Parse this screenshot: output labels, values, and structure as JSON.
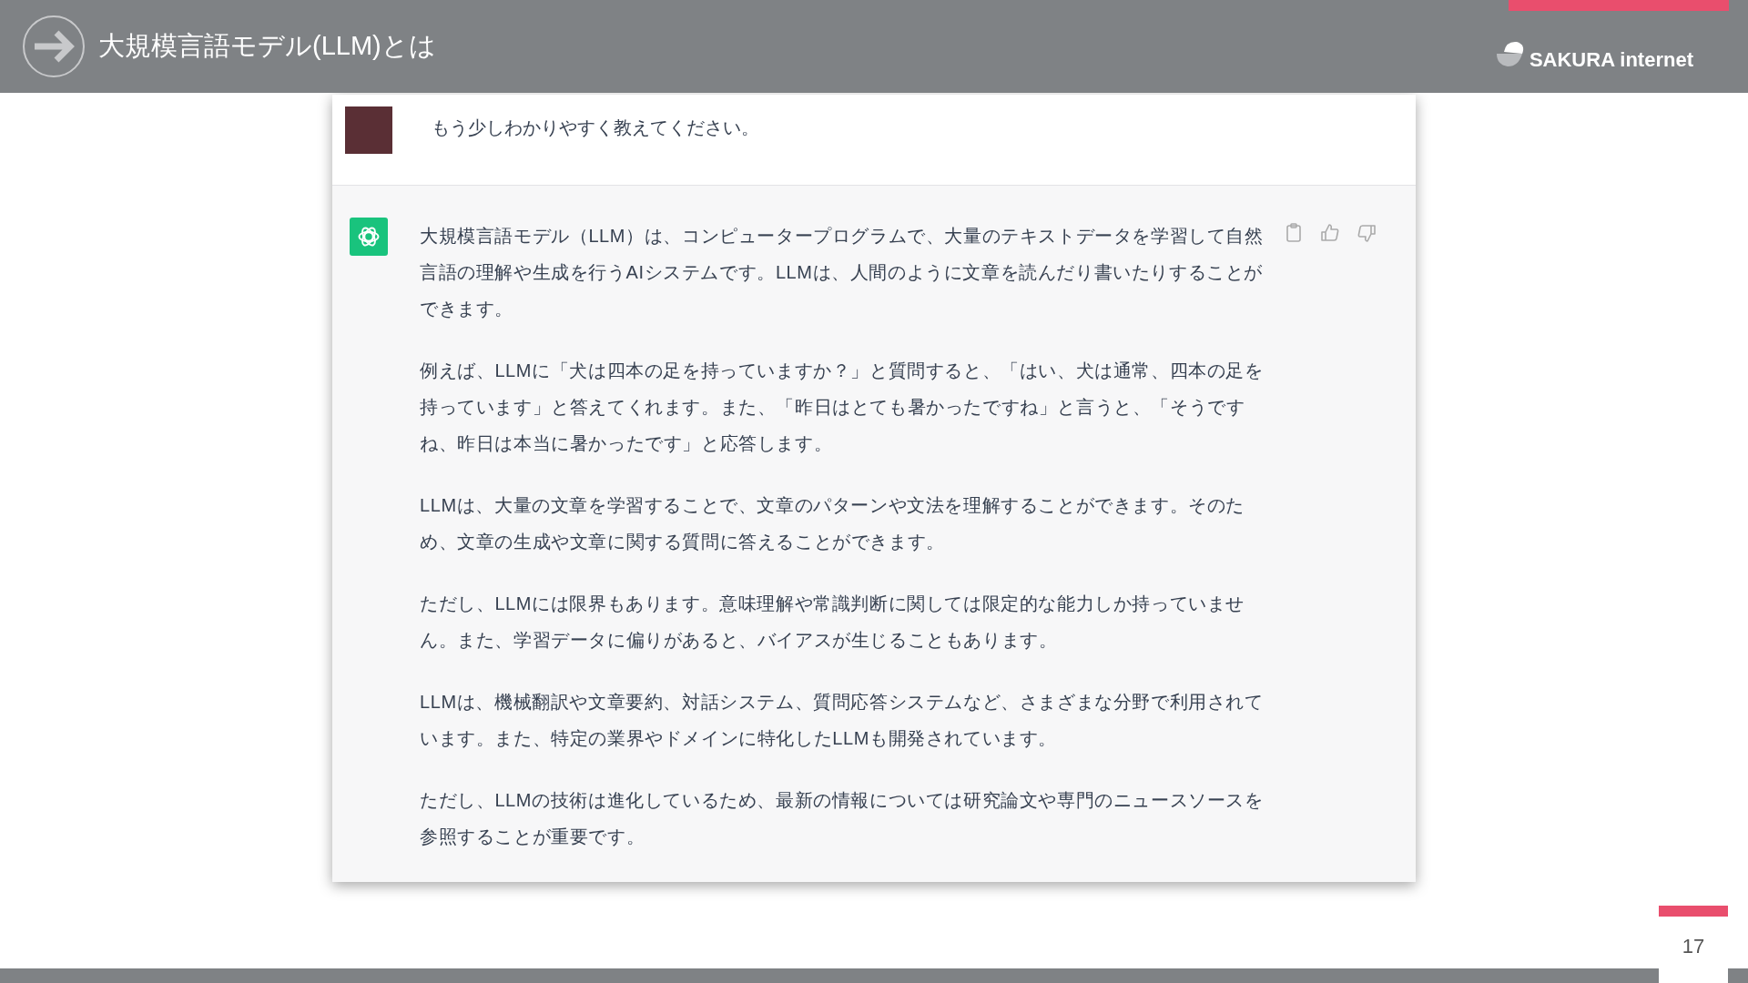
{
  "header": {
    "title": "大規模言語モデル(LLM)とは",
    "logo_text": "SAKURA internet"
  },
  "chat": {
    "user_message": "もう少しわかりやすく教えてください。",
    "assistant_paragraphs": [
      "大規模言語モデル（LLM）は、コンピュータープログラムで、大量のテキストデータを学習して自然言語の理解や生成を行うAIシステムです。LLMは、人間のように文章を読んだり書いたりすることができます。",
      "例えば、LLMに「犬は四本の足を持っていますか？」と質問すると、「はい、犬は通常、四本の足を持っています」と答えてくれます。また、「昨日はとても暑かったですね」と言うと、「そうですね、昨日は本当に暑かったです」と応答します。",
      "LLMは、大量の文章を学習することで、文章のパターンや文法を理解することができます。そのため、文章の生成や文章に関する質問に答えることができます。",
      "ただし、LLMには限界もあります。意味理解や常識判断に関しては限定的な能力しか持っていません。また、学習データに偏りがあると、バイアスが生じることもあります。",
      "LLMは、機械翻訳や文章要約、対話システム、質問応答システムなど、さまざまな分野で利用されています。また、特定の業界やドメインに特化したLLMも開発されています。",
      "ただし、LLMの技術は進化しているため、最新の情報については研究論文や専門のニュースソースを参照することが重要です。"
    ]
  },
  "page_number": "17"
}
